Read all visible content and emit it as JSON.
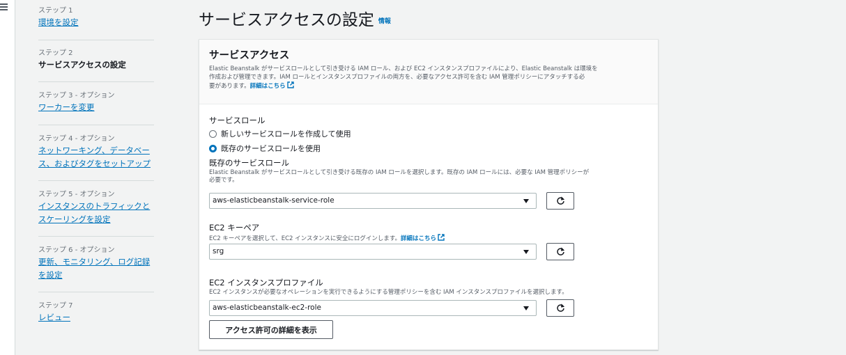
{
  "rail": {
    "menu_icon": "hamburger-menu-icon"
  },
  "steps": [
    {
      "label": "ステップ 1",
      "title": "環境を設定",
      "current": false
    },
    {
      "label": "ステップ 2",
      "title": "サービスアクセスの設定",
      "current": true
    },
    {
      "label": "ステップ 3 - オプション",
      "title": "ワーカーを変更",
      "current": false
    },
    {
      "label": "ステップ 4 - オプション",
      "title_line1": "ネットワーキング、データベー",
      "title_line2": "ス、およびタグをセットアップ",
      "current": false
    },
    {
      "label": "ステップ 5 - オプション",
      "title_line1": "インスタンスのトラフィックと",
      "title_line2": "スケーリングを設定",
      "current": false
    },
    {
      "label": "ステップ 6 - オプション",
      "title_line1": "更新、モニタリング、ログ記録",
      "title_line2": "を設定",
      "current": false
    },
    {
      "label": "ステップ 7",
      "title": "レビュー",
      "current": false
    }
  ],
  "page": {
    "title": "サービスアクセスの設定",
    "info_link": "情報"
  },
  "panel": {
    "title": "サービスアクセス",
    "desc_line1": "Elastic Beanstalk がサービスロールとして引き受ける IAM ロール、および EC2 インスタンスプロファイルにより、Elastic Beanstalk は環境を",
    "desc_line2": "作成および管理できます。IAM ロールとインスタンスプロファイルの両方を、必要なアクセス許可を含む IAM 管理ポリシーにアタッチする必",
    "desc_line3": "要があります。",
    "learn_more": "詳細はこちら",
    "service_role_heading": "サービスロール",
    "radio_new": "新しいサービスロールを作成して使用",
    "radio_existing": "既存のサービスロールを使用",
    "radio_selected": "existing",
    "existing_role_label": "既存のサービスロール",
    "existing_role_desc_line1": "Elastic Beanstalk がサービスロールとして引き受ける既存の IAM ロールを選択します。既存の IAM ロールには、必要な IAM 管理ポリシーが",
    "existing_role_desc_line2": "必要です。",
    "existing_role_value": "aws-elasticbeanstalk-service-role",
    "keypair_label": "EC2 キーペア",
    "keypair_desc": "EC2 キーペアを選択して、EC2 インスタンスに安全にログインします。",
    "keypair_learn_more": "詳細はこちら",
    "keypair_value": "srg",
    "profile_label": "EC2 インスタンスプロファイル",
    "profile_desc": "EC2 インスタンスが必要なオペレーションを実行できるようにする管理ポリシーを含む IAM インスタンスプロファイルを選択します。",
    "profile_value": "aws-elasticbeanstalk-ec2-role",
    "permissions_button": "アクセス許可の詳細を表示"
  },
  "colors": {
    "link": "#0073bb",
    "text": "#16191f",
    "muted": "#687078",
    "background": "#f2f3f3"
  }
}
